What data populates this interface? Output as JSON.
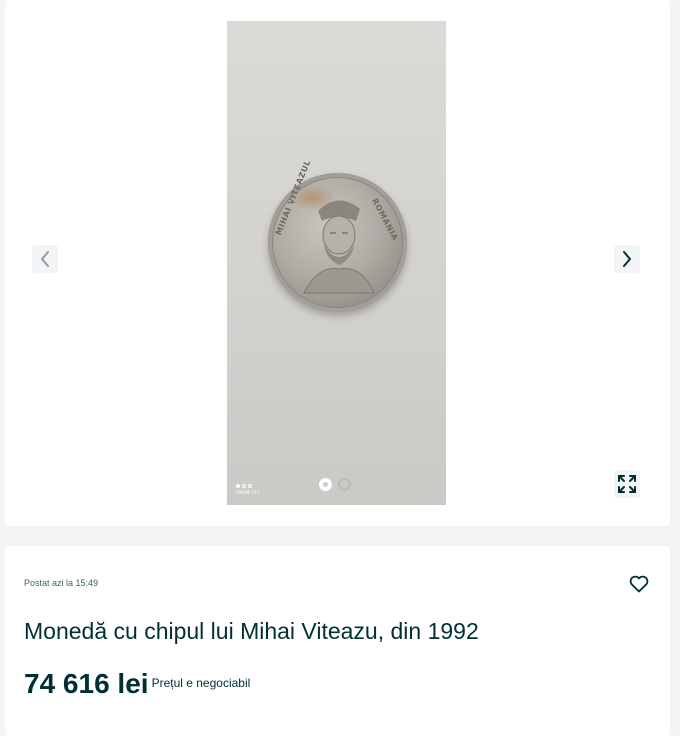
{
  "gallery": {
    "image_alt": "Monedă cu chipul lui Mihai Viteazu",
    "coin_inscription_left": "MIHAI VITEAZUL",
    "coin_inscription_right": "ROMANIA",
    "camera_watermark": "XIAOMI 11T",
    "current_index": 1,
    "total_images": 2,
    "prev_icon": "chevron-left-icon",
    "next_icon": "chevron-right-icon",
    "expand_icon": "fullscreen-expand-icon"
  },
  "listing": {
    "posted": "Postat azi la 15:49",
    "title": "Monedă cu chipul lui Mihai Viteazu, din 1992",
    "price": "74 616 lei",
    "price_note": "Prețul e negociabil",
    "favorite_icon": "heart-outline-icon"
  },
  "colors": {
    "text_primary": "#002f34",
    "text_secondary": "#406367",
    "page_background": "#f2f4f5",
    "card_background": "#ffffff"
  }
}
